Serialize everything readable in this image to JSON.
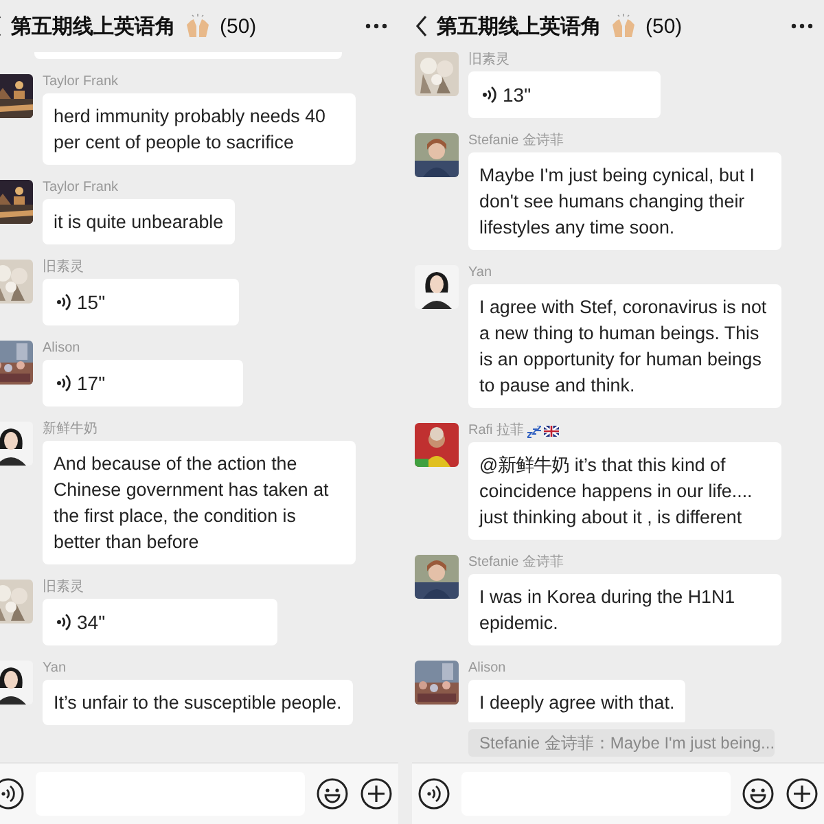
{
  "panels": [
    {
      "header": {
        "title": "第五期线上英语角",
        "count": "(50)"
      },
      "messages": [
        {
          "kind": "partial"
        },
        {
          "kind": "text",
          "sender": "Taylor Frank",
          "text": "herd immunity probably needs 40 per cent of people to sacrifice"
        },
        {
          "kind": "text",
          "sender": "Taylor Frank",
          "text": "it is quite unbearable"
        },
        {
          "kind": "voice",
          "sender": "旧素灵",
          "duration": "15\""
        },
        {
          "kind": "voice",
          "sender": "Alison",
          "duration": "17\""
        },
        {
          "kind": "text",
          "sender": "新鲜牛奶",
          "text": "And because of the action the Chinese government has taken at the first place,  the condition is better than before"
        },
        {
          "kind": "voice",
          "sender": "旧素灵",
          "duration": "34\""
        },
        {
          "kind": "text",
          "sender": "Yan",
          "text": "It’s unfair to the susceptible people."
        }
      ]
    },
    {
      "header": {
        "title": "第五期线上英语角",
        "count": "(50)"
      },
      "messages": [
        {
          "kind": "voice",
          "sender": "旧素灵",
          "duration": "13\""
        },
        {
          "kind": "text",
          "sender": "Stefanie 金诗菲",
          "text": "Maybe I'm just being cynical,  but I don't see humans changing their lifestyles any time soon."
        },
        {
          "kind": "text",
          "sender": "Yan",
          "text": "I agree with Stef, coronavirus is not a new thing to human beings. This is an opportunity for human beings to pause and think."
        },
        {
          "kind": "text",
          "sender": "Rafi 拉菲",
          "sender_badges": true,
          "text": "@新鲜牛奶  it’s that this kind of coincidence happens in our life.... just thinking about it , is  different"
        },
        {
          "kind": "text",
          "sender": "Stefanie 金诗菲",
          "text": "I was in Korea during the H1N1 epidemic."
        },
        {
          "kind": "text",
          "sender": "Alison",
          "text": "I deeply agree with that."
        }
      ],
      "quote": "Stefanie 金诗菲：Maybe I'm just being..."
    }
  ]
}
